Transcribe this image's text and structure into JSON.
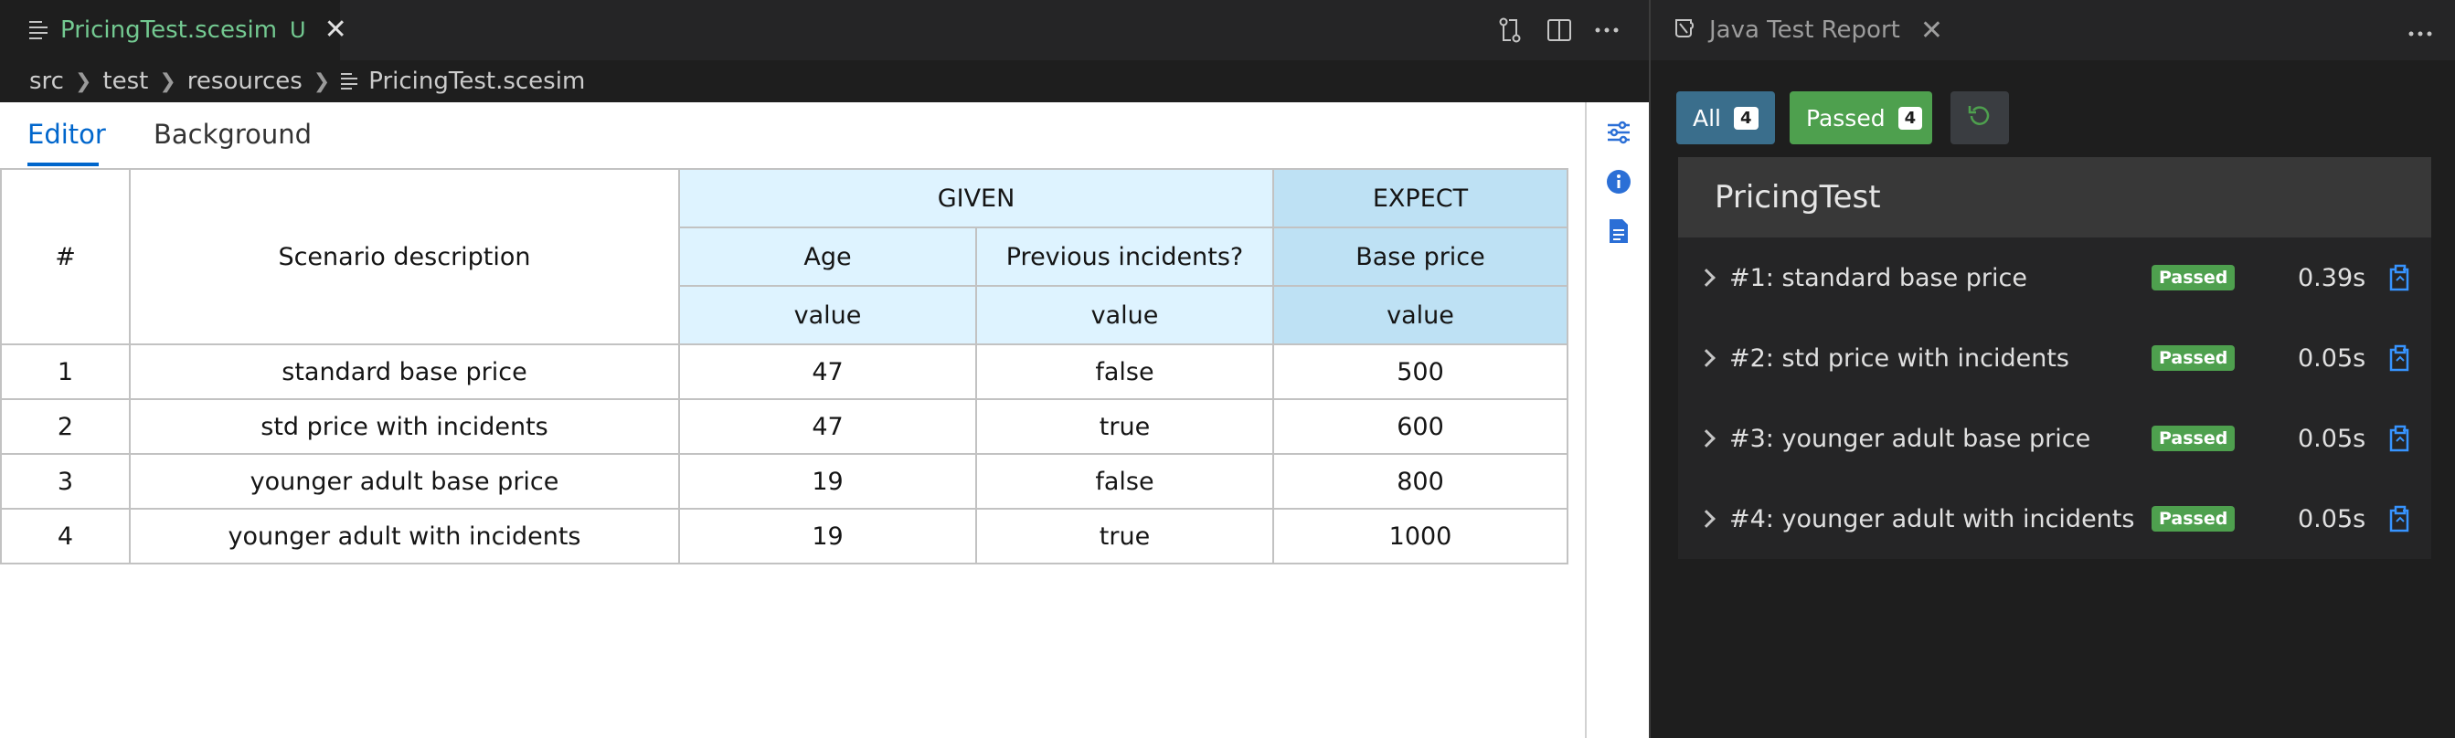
{
  "editor": {
    "tab": {
      "filename": "PricingTest.scesim",
      "status": "U"
    },
    "breadcrumb": [
      "src",
      "test",
      "resources",
      "PricingTest.scesim"
    ],
    "scesim": {
      "tabs": [
        "Editor",
        "Background"
      ],
      "grid": {
        "given_label": "GIVEN",
        "expect_label": "EXPECT",
        "index_header": "#",
        "description_header": "Scenario description",
        "columns": [
          "Age",
          "Previous incidents?",
          "Base price"
        ],
        "sub_header": "value",
        "rows": [
          [
            "1",
            "standard base price",
            "47",
            "false",
            "500"
          ],
          [
            "2",
            "std price with incidents",
            "47",
            "true",
            "600"
          ],
          [
            "3",
            "younger adult base price",
            "19",
            "false",
            "800"
          ],
          [
            "4",
            "younger adult with incidents",
            "19",
            "true",
            "1000"
          ]
        ]
      }
    }
  },
  "report": {
    "title": "Java Test Report",
    "filters": {
      "all_label": "All",
      "all_count": "4",
      "passed_label": "Passed",
      "passed_count": "4"
    },
    "suite_name": "PricingTest",
    "cases": [
      {
        "name": "#1: standard base price",
        "status": "Passed",
        "time": "0.39s"
      },
      {
        "name": "#2: std price with incidents",
        "status": "Passed",
        "time": "0.05s"
      },
      {
        "name": "#3: younger adult base price",
        "status": "Passed",
        "time": "0.05s"
      },
      {
        "name": "#4: younger adult with incidents",
        "status": "Passed",
        "time": "0.05s"
      }
    ]
  },
  "colors": {
    "accent_blue": "#0066cc",
    "passed_green": "#4ea04e",
    "given_bg": "#def3ff",
    "expect_bg": "#bee1f4"
  },
  "icons": [
    "file-lines-icon",
    "close-icon",
    "compare-changes-icon",
    "split-editor-icon",
    "more-icon",
    "settings-sliders-icon",
    "info-icon",
    "document-icon",
    "beaker-icon",
    "refresh-icon",
    "chevron-right-icon",
    "copy-icon"
  ]
}
